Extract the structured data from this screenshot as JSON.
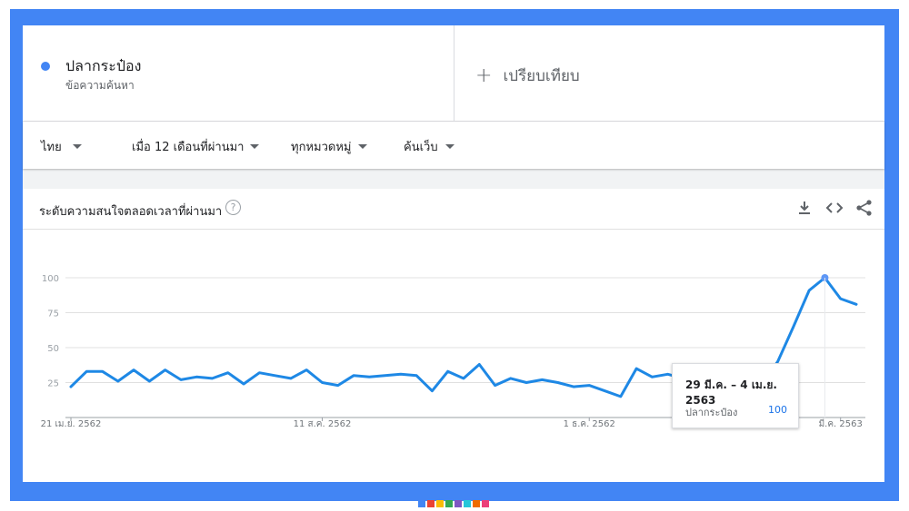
{
  "term": {
    "name": "ปลากระป๋อง",
    "subtitle": "ข้อความค้นหา",
    "color": "#4285f4"
  },
  "compare": {
    "plus": "+",
    "label": "เปรียบเทียบ"
  },
  "filters": {
    "region": "ไทย",
    "time": "เมื่อ 12 เดือนที่ผ่านมา",
    "category": "ทุกหมวดหมู่",
    "search_type": "ค้นเว็บ"
  },
  "chart_header": {
    "title": "ระดับความสนใจตลอดเวลาที่ผ่านมา",
    "help_icon": "?",
    "icons": [
      "download-icon",
      "embed-icon",
      "share-icon"
    ]
  },
  "tooltip": {
    "date": "29 มี.ค. – 4 เม.ย. 2563",
    "label": "ปลากระป๋อง",
    "value": "100"
  },
  "chart_data": {
    "type": "line",
    "title": "ระดับความสนใจตลอดเวลาที่ผ่านมา",
    "xlabel": "",
    "ylabel": "",
    "ylim": [
      0,
      100
    ],
    "y_ticks": [
      25,
      50,
      75,
      100
    ],
    "x_tick_labels": [
      "21 เม.ย. 2562",
      "11 ส.ค. 2562",
      "1 ธ.ค. 2562",
      "มี.ค. 2563"
    ],
    "grid": true,
    "line_color": "#1e88e5",
    "series": [
      {
        "values": [
          22,
          33,
          33,
          26,
          34,
          26,
          34,
          27,
          29,
          28,
          32,
          24,
          32,
          30,
          28,
          34,
          25,
          23,
          30,
          29,
          30,
          31,
          30,
          19,
          33,
          28,
          38,
          23,
          28,
          25,
          27,
          25,
          22,
          23,
          19,
          15,
          35,
          29,
          31,
          28,
          27,
          31,
          24,
          23,
          24,
          40,
          65,
          91,
          100,
          85,
          81
        ]
      }
    ],
    "highlight_index": 48
  },
  "footer_colors": [
    "#4285f4",
    "#ea4335",
    "#fbbc04",
    "#34a853",
    "#7e57c2",
    "#26c6da",
    "#ef6c00",
    "#ec407a"
  ]
}
